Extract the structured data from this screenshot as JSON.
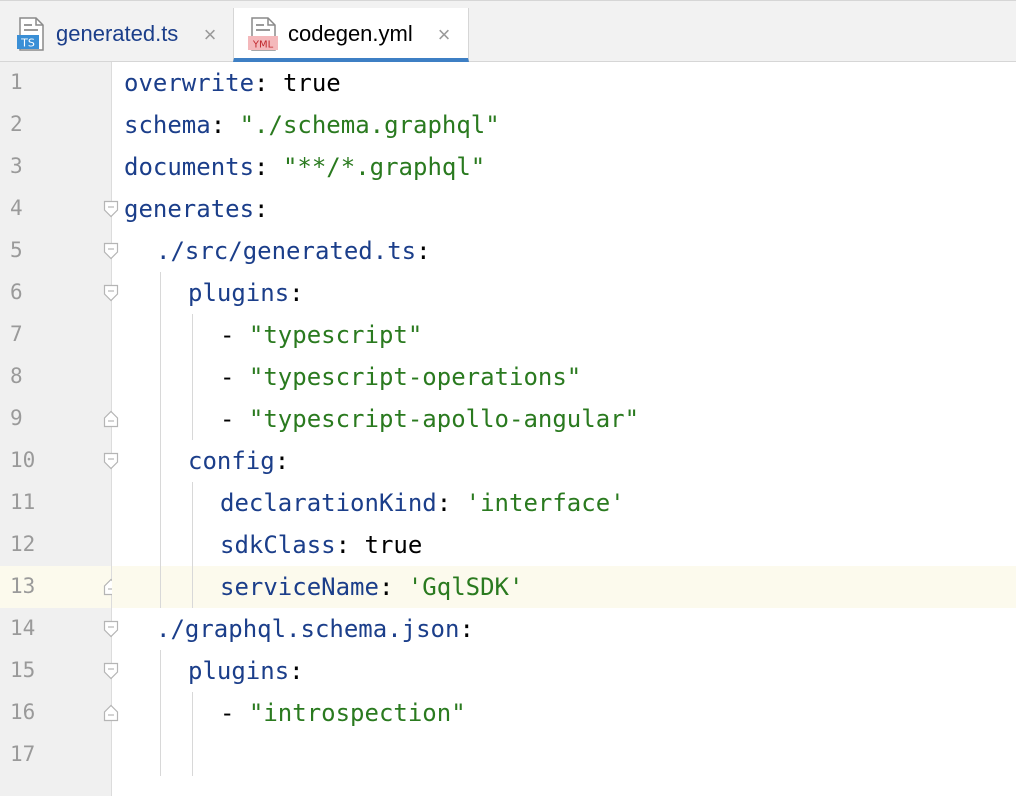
{
  "tabs": [
    {
      "label": "generated.ts",
      "icon": "ts-file-icon",
      "icon_text": "TS",
      "active": false
    },
    {
      "label": "codegen.yml",
      "icon": "yml-file-icon",
      "icon_text": "YML",
      "active": true
    }
  ],
  "close_glyph": "×",
  "current_line": 13,
  "colors": {
    "key": "#1b3e8a",
    "string": "#2a7a1f",
    "plain": "#000000",
    "accent": "#3d7fc4"
  },
  "lines": [
    {
      "n": "1",
      "key": "overwrite",
      "sep": ": ",
      "val": "true",
      "val_type": "plain",
      "indent": 0,
      "fold": ""
    },
    {
      "n": "2",
      "key": "schema",
      "sep": ": ",
      "val": "\"./schema.graphql\"",
      "val_type": "str",
      "indent": 0,
      "fold": ""
    },
    {
      "n": "3",
      "key": "documents",
      "sep": ": ",
      "val": "\"**/*.graphql\"",
      "val_type": "str",
      "indent": 0,
      "fold": ""
    },
    {
      "n": "4",
      "key": "generates",
      "sep": ":",
      "val": "",
      "val_type": "plain",
      "indent": 0,
      "fold": "open"
    },
    {
      "n": "5",
      "key": "./src/generated.ts",
      "sep": ":",
      "val": "",
      "val_type": "plain",
      "indent": 1,
      "fold": "open"
    },
    {
      "n": "6",
      "key": "plugins",
      "sep": ":",
      "val": "",
      "val_type": "plain",
      "indent": 2,
      "fold": "open"
    },
    {
      "n": "7",
      "key": "",
      "sep": "- ",
      "val": "\"typescript\"",
      "val_type": "str",
      "indent": 3,
      "fold": ""
    },
    {
      "n": "8",
      "key": "",
      "sep": "- ",
      "val": "\"typescript-operations\"",
      "val_type": "str",
      "indent": 3,
      "fold": ""
    },
    {
      "n": "9",
      "key": "",
      "sep": "- ",
      "val": "\"typescript-apollo-angular\"",
      "val_type": "str",
      "indent": 3,
      "fold": "close"
    },
    {
      "n": "10",
      "key": "config",
      "sep": ":",
      "val": "",
      "val_type": "plain",
      "indent": 2,
      "fold": "open"
    },
    {
      "n": "11",
      "key": "declarationKind",
      "sep": ": ",
      "val": "'interface'",
      "val_type": "str",
      "indent": 3,
      "fold": ""
    },
    {
      "n": "12",
      "key": "sdkClass",
      "sep": ": ",
      "val": "true",
      "val_type": "plain",
      "indent": 3,
      "fold": ""
    },
    {
      "n": "13",
      "key": "serviceName",
      "sep": ": ",
      "val": "'GqlSDK'",
      "val_type": "str",
      "indent": 3,
      "fold": "close"
    },
    {
      "n": "14",
      "key": "./graphql.schema.json",
      "sep": ":",
      "val": "",
      "val_type": "plain",
      "indent": 1,
      "fold": "open"
    },
    {
      "n": "15",
      "key": "plugins",
      "sep": ":",
      "val": "",
      "val_type": "plain",
      "indent": 2,
      "fold": "open"
    },
    {
      "n": "16",
      "key": "",
      "sep": "- ",
      "val": "\"introspection\"",
      "val_type": "str",
      "indent": 3,
      "fold": "close"
    },
    {
      "n": "17",
      "key": "",
      "sep": "",
      "val": "",
      "val_type": "plain",
      "indent": 0,
      "fold": ""
    }
  ]
}
